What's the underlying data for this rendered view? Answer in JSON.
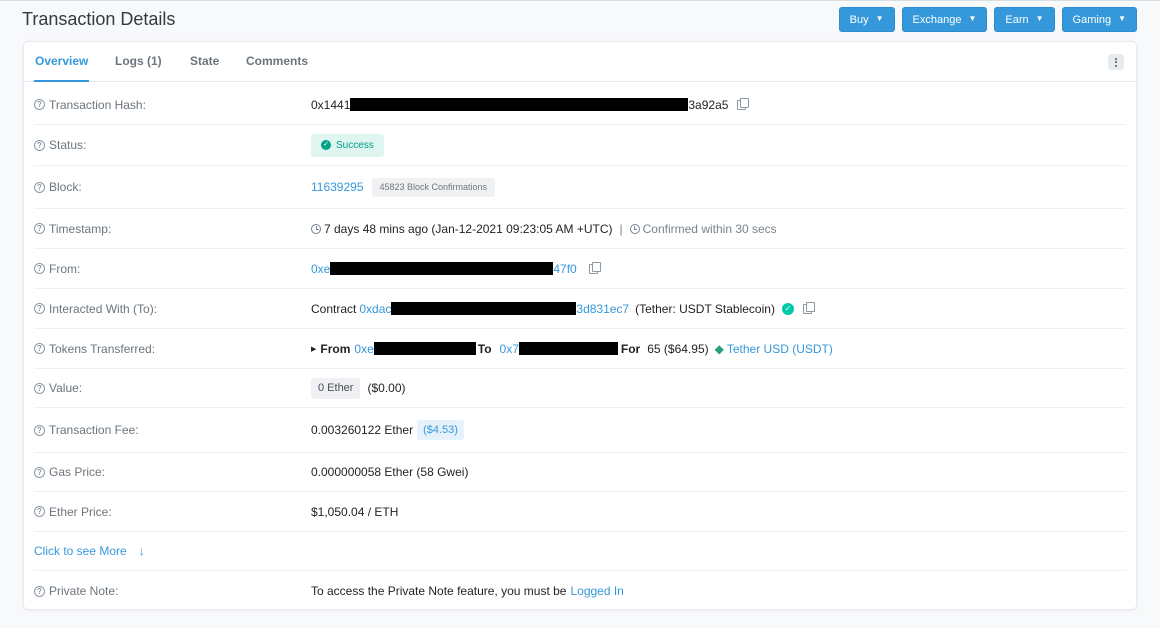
{
  "page_title": "Transaction Details",
  "header_buttons": [
    {
      "label": "Buy"
    },
    {
      "label": "Exchange"
    },
    {
      "label": "Earn"
    },
    {
      "label": "Gaming"
    }
  ],
  "tabs": [
    {
      "label": "Overview",
      "active": true
    },
    {
      "label": "Logs (1)"
    },
    {
      "label": "State"
    },
    {
      "label": "Comments"
    }
  ],
  "details": {
    "tx_hash": {
      "label": "Transaction Hash:",
      "prefix": "0x1441",
      "suffix": "3a92a5"
    },
    "status": {
      "label": "Status:",
      "value": "Success"
    },
    "block": {
      "label": "Block:",
      "number": "11639295",
      "confirmations": "45823 Block Confirmations"
    },
    "timestamp": {
      "label": "Timestamp:",
      "value": "7 days 48 mins ago (Jan-12-2021 09:23:05 AM +UTC)",
      "separator": "|",
      "confirmed": "Confirmed within 30 secs"
    },
    "from": {
      "label": "From:",
      "prefix": "0xe",
      "suffix": "47f0"
    },
    "interacted": {
      "label": "Interacted With (To):",
      "contract_word": "Contract",
      "prefix": "0xdac",
      "suffix": "3d831ec7",
      "name": "(Tether: USDT Stablecoin)"
    },
    "tokens": {
      "label": "Tokens Transferred:",
      "from_word": "From",
      "from_prefix": "0xe",
      "to_word": "To",
      "to_prefix": "0x7",
      "for_word": "For",
      "amount": "65 ($64.95)",
      "token": "Tether USD (USDT)"
    },
    "value": {
      "label": "Value:",
      "ether": "0 Ether",
      "usd": "($0.00)"
    },
    "fee": {
      "label": "Transaction Fee:",
      "ether": "0.003260122 Ether",
      "usd": "($4.53)"
    },
    "gas_price": {
      "label": "Gas Price:",
      "value": "0.000000058 Ether (58 Gwei)"
    },
    "ether_price": {
      "label": "Ether Price:",
      "value": "$1,050.04 / ETH"
    },
    "see_more": {
      "label": "Click to see More"
    },
    "private_note": {
      "label": "Private Note:",
      "text": "To access the Private Note feature, you must be",
      "link": "Logged In"
    }
  },
  "colors": {
    "accent": "#3498db",
    "success": "#00a186",
    "tether": "#26a17b"
  }
}
